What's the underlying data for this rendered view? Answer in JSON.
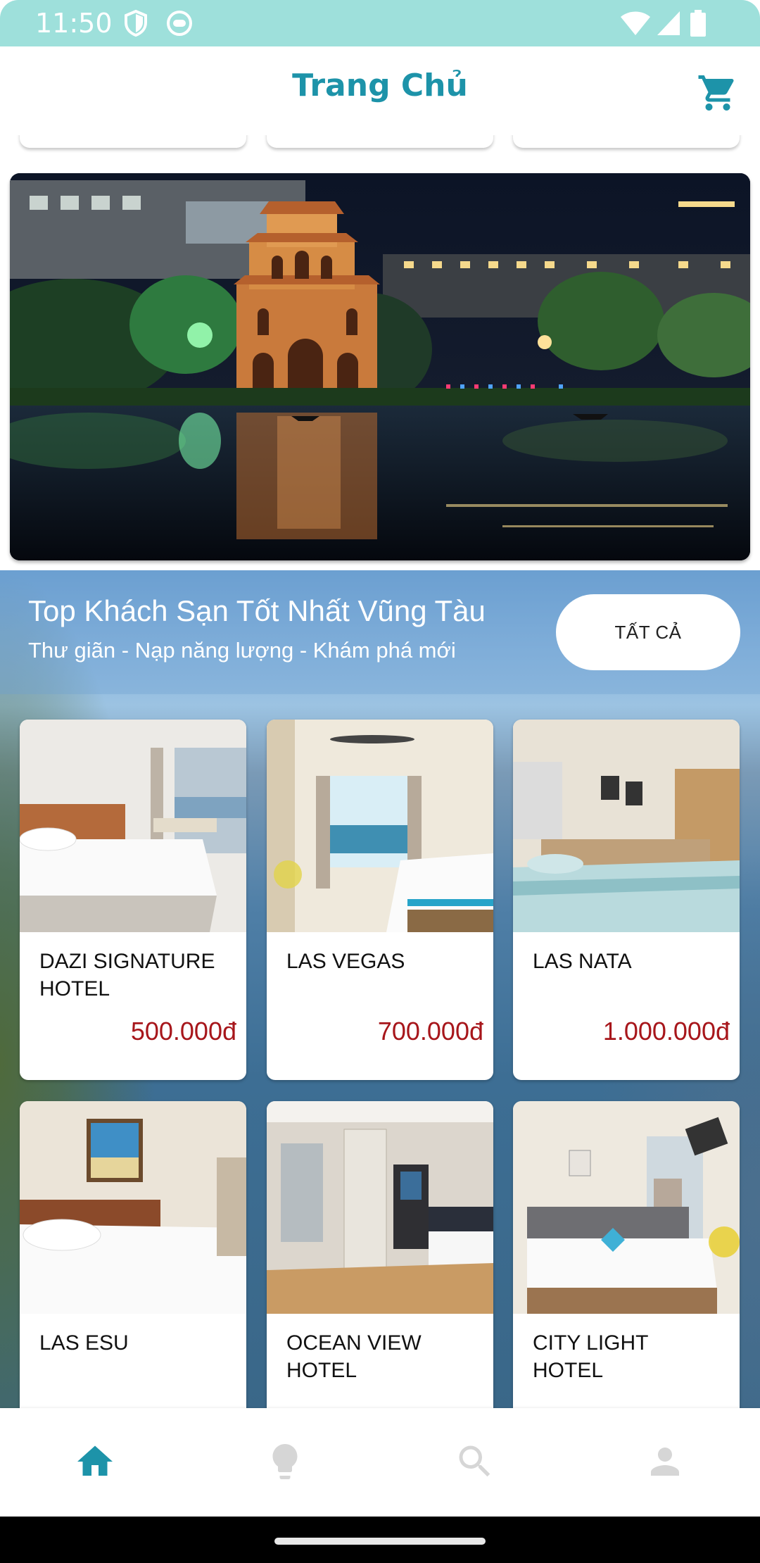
{
  "status_bar": {
    "time": "11:50",
    "background": "#9ee0db"
  },
  "app_bar": {
    "title": "Trang Chủ",
    "accent": "#1d93a9",
    "cart_icon": "shopping-cart-icon"
  },
  "banner": {
    "subject": "hoan-kiem-lake-turtle-tower-night"
  },
  "section": {
    "title": "Top Khách Sạn Tốt Nhất Vũng Tàu",
    "subtitle": "Thư giãn - Nạp năng lượng - Khám phá mới",
    "see_all_label": "TẤT CẢ"
  },
  "hotels": [
    {
      "name": "DAZI SIGNATURE HOTEL",
      "price": "500.000đ"
    },
    {
      "name": "LAS VEGAS",
      "price": "700.000đ"
    },
    {
      "name": "LAS NATA",
      "price": "1.000.000đ"
    },
    {
      "name": "LAS ESU",
      "price": ""
    },
    {
      "name": "OCEAN VIEW HOTEL",
      "price": ""
    },
    {
      "name": "CITY LIGHT HOTEL",
      "price": ""
    }
  ],
  "price_color": "#a7161b",
  "bottom_nav": {
    "items": [
      {
        "icon": "home-icon",
        "active": true
      },
      {
        "icon": "lightbulb-icon",
        "active": false
      },
      {
        "icon": "search-icon",
        "active": false
      },
      {
        "icon": "person-icon",
        "active": false
      }
    ],
    "active_color": "#1d93a9",
    "inactive_color": "#d6d6d6"
  }
}
